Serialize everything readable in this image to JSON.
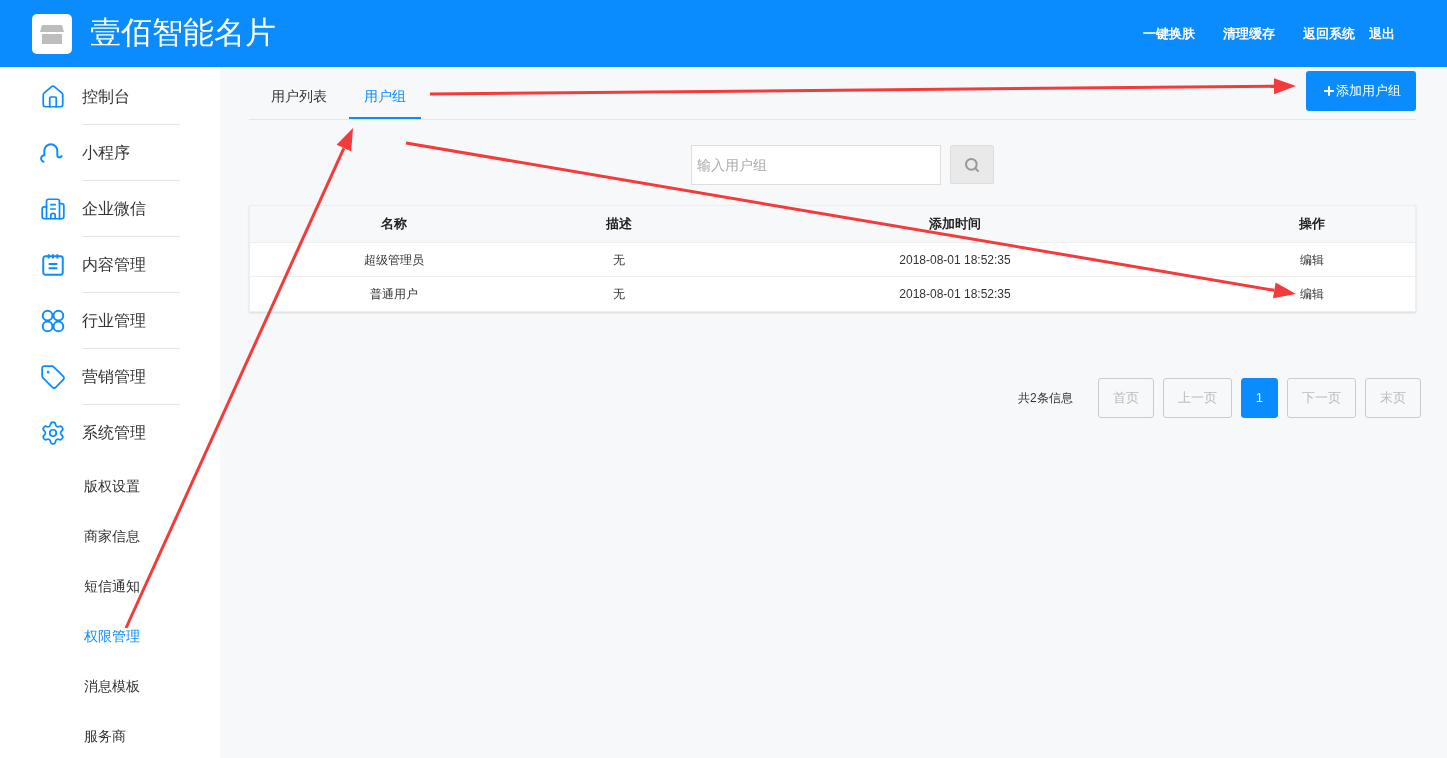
{
  "header": {
    "title": "壹佰智能名片",
    "links": [
      "一键换肤",
      "清理缓存",
      "返回系统",
      "退出"
    ]
  },
  "sidebar": {
    "items": [
      {
        "label": "控制台",
        "kind": "main",
        "selected": false
      },
      {
        "label": "小程序",
        "kind": "main",
        "selected": false
      },
      {
        "label": "企业微信",
        "kind": "main",
        "selected": false
      },
      {
        "label": "内容管理",
        "kind": "main",
        "selected": false
      },
      {
        "label": "行业管理",
        "kind": "main",
        "selected": false
      },
      {
        "label": "营销管理",
        "kind": "main",
        "selected": false
      },
      {
        "label": "系统管理",
        "kind": "main",
        "selected": false
      },
      {
        "label": "版权设置",
        "kind": "sub",
        "selected": false
      },
      {
        "label": "商家信息",
        "kind": "sub",
        "selected": false
      },
      {
        "label": "短信通知",
        "kind": "sub",
        "selected": false
      },
      {
        "label": "权限管理",
        "kind": "sub",
        "selected": true
      },
      {
        "label": "消息模板",
        "kind": "sub",
        "selected": false
      },
      {
        "label": "服务商",
        "kind": "sub",
        "selected": false
      }
    ]
  },
  "tabs": [
    {
      "label": "用户列表",
      "selected": false
    },
    {
      "label": "用户组",
      "selected": true
    }
  ],
  "add_button": "添加用户组",
  "search": {
    "placeholder": "输入用户组"
  },
  "table": {
    "columns": [
      "名称",
      "描述",
      "添加时间",
      "操作"
    ],
    "rows": [
      {
        "name": "超级管理员",
        "description": "无",
        "time": "2018-08-01 18:52:35",
        "action": "编辑"
      },
      {
        "name": "普通用户",
        "description": "无",
        "time": "2018-08-01 18:52:35",
        "action": "编辑"
      }
    ]
  },
  "pagination": {
    "summary": "共2条信息",
    "buttons": [
      {
        "label": "首页",
        "selected": false,
        "disabled": true
      },
      {
        "label": "上一页",
        "selected": false,
        "disabled": true
      },
      {
        "label": "1",
        "selected": true,
        "disabled": false
      },
      {
        "label": "下一页",
        "selected": false,
        "disabled": true
      },
      {
        "label": "末页",
        "selected": false,
        "disabled": true
      }
    ]
  }
}
